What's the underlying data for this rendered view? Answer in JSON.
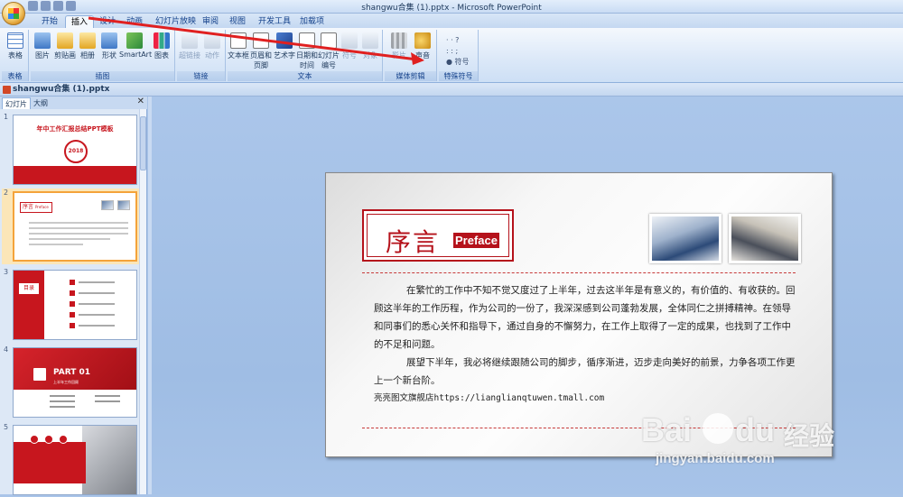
{
  "window": {
    "title": "shangwu合集 (1).pptx - Microsoft PowerPoint"
  },
  "ribbon": {
    "tabs": [
      "开始",
      "插入",
      "设计",
      "动画",
      "幻灯片放映",
      "审阅",
      "视图",
      "开发工具",
      "加载项"
    ],
    "active_tab": "插入",
    "groups": {
      "tables": {
        "label": "表格",
        "buttons": [
          "表格"
        ]
      },
      "illustrations": {
        "label": "插图",
        "buttons": [
          "图片",
          "剪贴画",
          "相册",
          "形状",
          "SmartArt",
          "图表"
        ]
      },
      "links": {
        "label": "链接",
        "buttons": [
          "超链接",
          "动作"
        ]
      },
      "text": {
        "label": "文本",
        "buttons": [
          "文本框",
          "页眉和页脚",
          "艺术字",
          "日期和时间",
          "幻灯片编号",
          "符号",
          "对象"
        ]
      },
      "media": {
        "label": "媒体剪辑",
        "buttons": [
          "影片",
          "声音"
        ]
      },
      "special": {
        "label": "特殊符号",
        "buttons": [
          "符号"
        ]
      }
    }
  },
  "document": {
    "tab_name": "shangwu合集 (1).pptx"
  },
  "pane": {
    "tabs": [
      "幻灯片",
      "大纲"
    ],
    "slides": [
      {
        "num": "1",
        "title": "年中工作汇报总结PPT模板",
        "badge": "2018"
      },
      {
        "num": "2",
        "title": "序言",
        "badge": "Preface"
      },
      {
        "num": "3",
        "title": "目录"
      },
      {
        "num": "4",
        "title": "PART 01",
        "subtitle": "上半年工作回顾"
      },
      {
        "num": "5"
      }
    ]
  },
  "slide": {
    "title_cn": "序言",
    "title_en": "Preface",
    "paragraph1": "在繁忙的工作中不知不觉又度过了上半年，过去这半年是有意义的，有价值的、有收获的。回顾这半年的工作历程，作为公司的一份了，我深深感到公司蓬勃发展，全体同仁之拼搏精神。在领导和同事们的悉心关怀和指导下，通过自身的不懈努力，在工作上取得了一定的成果，也找到了工作中的不足和问题。",
    "paragraph2": "展望下半年，我必将继续跟随公司的脚步，循序渐进，迈步走向美好的前景，力争各项工作更上一个新台阶。",
    "store_line": "亮亮图文旗舰店https://lianglianqtuwen.tmall.com"
  },
  "watermark": {
    "brand_latin": "Bai",
    "brand_du": "du",
    "brand_cn": "经验",
    "url": "jingyan.baidu.com"
  },
  "colors": {
    "accent_red": "#b5121b",
    "ribbon_blue": "#15428b",
    "selection_orange": "#f4a33a"
  }
}
